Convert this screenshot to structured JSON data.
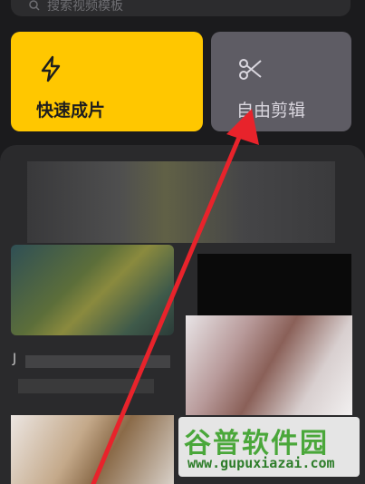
{
  "search": {
    "placeholder": "搜索视频模板"
  },
  "cards": {
    "quick": {
      "label": "快速成片",
      "icon": "lightning-icon",
      "color": "#ffc700"
    },
    "free": {
      "label": "自由剪辑",
      "icon": "scissors-icon",
      "color": "#5e5c64"
    }
  },
  "feed": {
    "blurred_title": "J"
  },
  "watermark": {
    "logo": "谷普软件园",
    "url": "www.gupuxiazai.com"
  },
  "annotation": {
    "arrow_color": "#e8232b"
  }
}
